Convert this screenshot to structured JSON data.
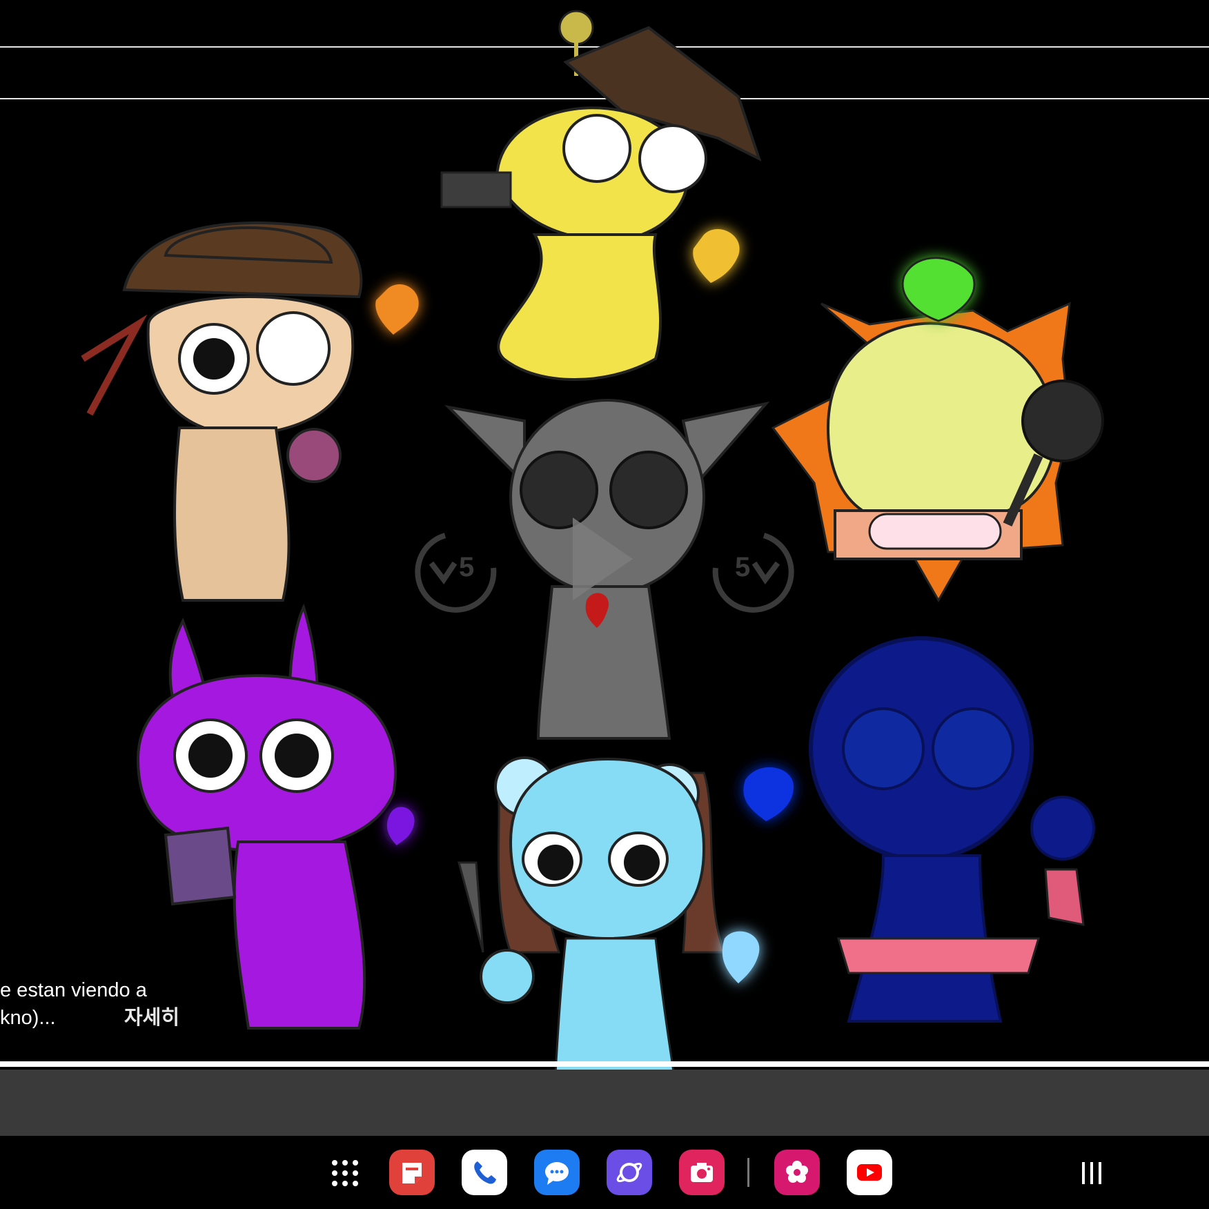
{
  "video": {
    "caption_line1": "e estan viendo a",
    "caption_line2": "kno)...",
    "more_label": "자세히",
    "rewind_seconds": "5",
    "forward_seconds": "5"
  },
  "taskbar": {
    "apps": [
      {
        "name": "notes-app",
        "color": "#e0413a"
      },
      {
        "name": "phone-app",
        "color": "#ffffff"
      },
      {
        "name": "messages-app",
        "color": "#1d7cf2"
      },
      {
        "name": "internet-app",
        "color": "#6b4ee6"
      },
      {
        "name": "camera-app",
        "color": "#e0245e"
      },
      {
        "name": "gallery-app",
        "color": "#d6186f"
      },
      {
        "name": "youtube-app",
        "color": "#ffffff"
      }
    ]
  }
}
